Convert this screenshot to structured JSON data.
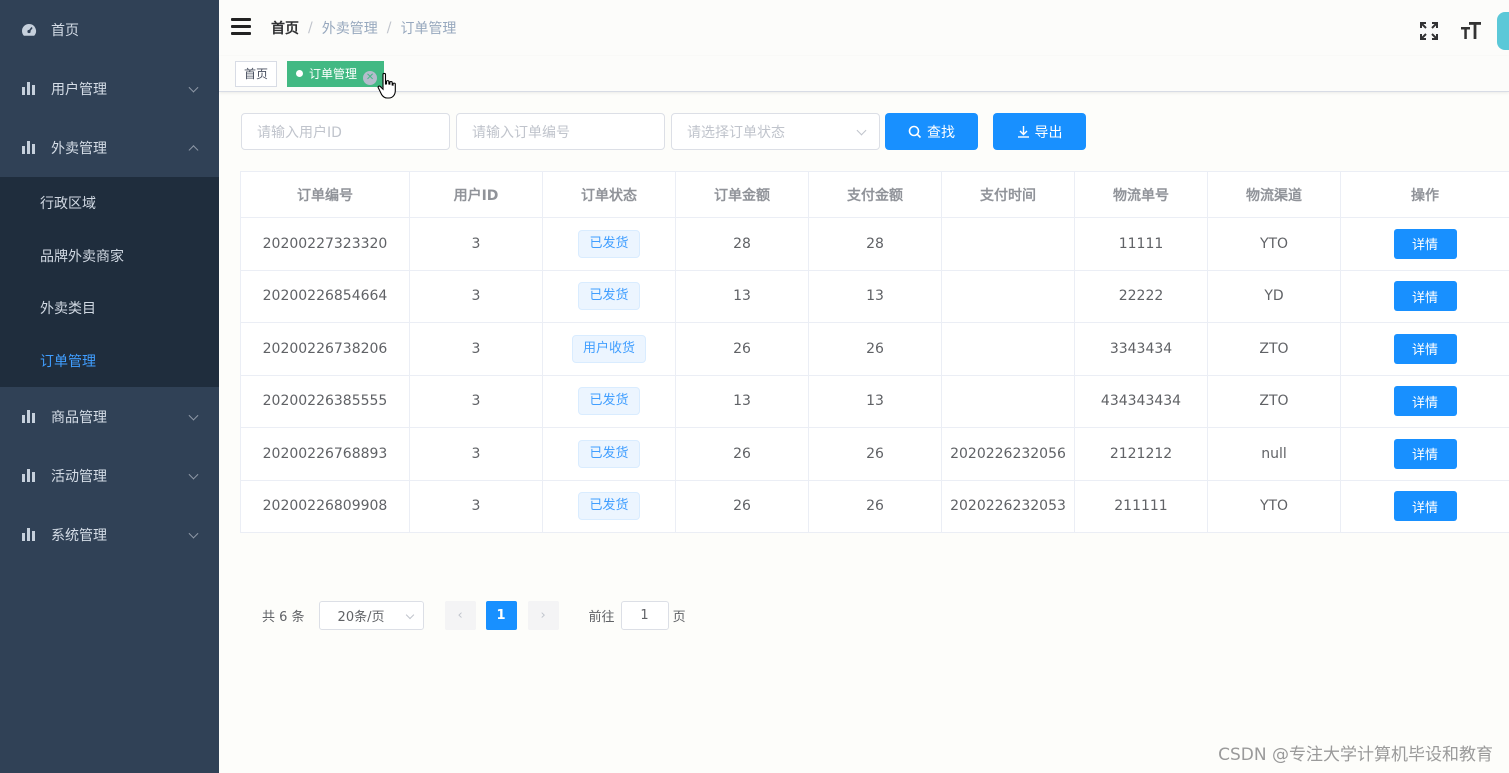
{
  "sidebar": {
    "home": {
      "label": "首页",
      "icon": "dashboard-icon"
    },
    "menus": [
      {
        "label": "用户管理",
        "icon": "bar-chart-icon"
      },
      {
        "label": "外卖管理",
        "icon": "bar-chart-icon"
      }
    ],
    "submenu": [
      {
        "label": "行政区域"
      },
      {
        "label": "品牌外卖商家"
      },
      {
        "label": "外卖类目"
      },
      {
        "label": "订单管理"
      }
    ],
    "menus_after": [
      {
        "label": "商品管理",
        "icon": "bar-chart-icon"
      },
      {
        "label": "活动管理",
        "icon": "bar-chart-icon"
      },
      {
        "label": "系统管理",
        "icon": "bar-chart-icon"
      }
    ],
    "colors": {
      "background": "#304156",
      "submenu_background": "#1f2d3d",
      "active_text": "#409eff"
    }
  },
  "header": {
    "breadcrumb": [
      "首页",
      "外卖管理",
      "订单管理"
    ],
    "separator": "/"
  },
  "tags": {
    "home": "首页",
    "active": "订单管理",
    "active_color": "#42b983"
  },
  "filters": {
    "user_id_placeholder": "请输入用户ID",
    "order_no_placeholder": "请输入订单编号",
    "status_placeholder": "请选择订单状态",
    "search_label": "查找",
    "export_label": "导出",
    "button_color": "#1890ff"
  },
  "table": {
    "headers": [
      "订单编号",
      "用户ID",
      "订单状态",
      "订单金额",
      "支付金额",
      "支付时间",
      "物流单号",
      "物流渠道",
      "操作"
    ],
    "rows": [
      [
        "20200227323320",
        "3",
        "已发货",
        "28",
        "28",
        "",
        "11111",
        "YTO"
      ],
      [
        "20200226854664",
        "3",
        "已发货",
        "13",
        "13",
        "",
        "22222",
        "YD"
      ],
      [
        "20200226738206",
        "3",
        "用户收货",
        "26",
        "26",
        "",
        "3343434",
        "ZTO"
      ],
      [
        "20200226385555",
        "3",
        "已发货",
        "13",
        "13",
        "",
        "434343434",
        "ZTO"
      ],
      [
        "20200226768893",
        "3",
        "已发货",
        "26",
        "26",
        "2020226232056",
        "2121212",
        "null"
      ],
      [
        "20200226809908",
        "3",
        "已发货",
        "26",
        "26",
        "2020226232053",
        "211111",
        "YTO"
      ]
    ],
    "action_label": "详情"
  },
  "pagination": {
    "total": "共 6 条",
    "page_size": "20条/页",
    "current_page": "1",
    "goto_prefix": "前往",
    "goto_value": "1",
    "goto_suffix": "页"
  },
  "watermark": "CSDN @专注大学计算机毕设和教育"
}
